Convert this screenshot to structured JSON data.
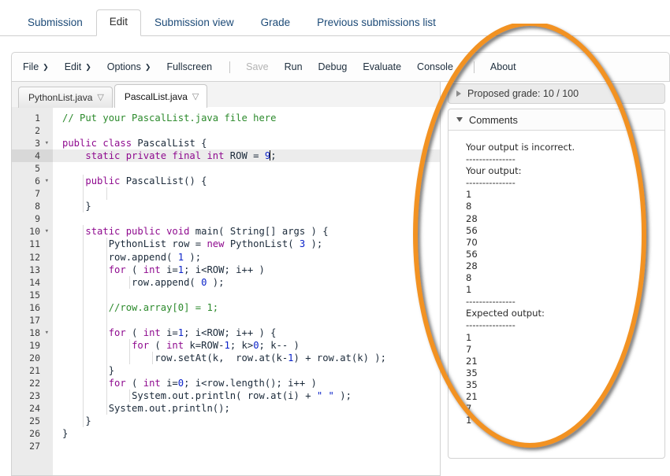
{
  "nav": {
    "tabs": [
      {
        "label": "Submission",
        "active": false
      },
      {
        "label": "Edit",
        "active": true
      },
      {
        "label": "Submission view",
        "active": false
      },
      {
        "label": "Grade",
        "active": false
      },
      {
        "label": "Previous submissions list",
        "active": false
      }
    ]
  },
  "toolbar": {
    "file": "File",
    "edit": "Edit",
    "options": "Options",
    "fullscreen": "Fullscreen",
    "save": "Save",
    "run": "Run",
    "debug": "Debug",
    "evaluate": "Evaluate",
    "console": "Console",
    "about": "About",
    "caret": "❯"
  },
  "filetabs": [
    {
      "label": "PythonList.java",
      "active": false,
      "menu_icon": "▽"
    },
    {
      "label": "PascalList.java",
      "active": true,
      "menu_icon": "▽"
    }
  ],
  "editor": {
    "active_line": 4,
    "lines": [
      {
        "n": "1",
        "fold": "",
        "indent": 0,
        "html": "<span class=\"cm\">// Put your PascalList.java file here</span>"
      },
      {
        "n": "2",
        "fold": "",
        "indent": 0,
        "html": ""
      },
      {
        "n": "3",
        "fold": "▾",
        "indent": 0,
        "html": "<span class=\"k\">public class</span> <span class=\"id\">PascalList</span> {"
      },
      {
        "n": "4",
        "fold": "",
        "indent": 0,
        "html": "    <span class=\"k\">static private final int</span> ROW = <span class=\"n\">9</span><span class=\"caret\"></span>;"
      },
      {
        "n": "5",
        "fold": "",
        "indent": 0,
        "html": ""
      },
      {
        "n": "6",
        "fold": "▾",
        "indent": 1,
        "html": "    <span class=\"k\">public</span> <span class=\"id\">PascalList</span>() {"
      },
      {
        "n": "7",
        "fold": "",
        "indent": 2,
        "html": ""
      },
      {
        "n": "8",
        "fold": "",
        "indent": 1,
        "html": "    }"
      },
      {
        "n": "9",
        "fold": "",
        "indent": 0,
        "html": ""
      },
      {
        "n": "10",
        "fold": "▾",
        "indent": 1,
        "html": "    <span class=\"k\">static public void</span> main( <span class=\"id\">String</span>[] args ) {"
      },
      {
        "n": "11",
        "fold": "",
        "indent": 2,
        "html": "        <span class=\"id\">PythonList</span> row = <span class=\"k\">new</span> <span class=\"id\">PythonList</span>( <span class=\"n\">3</span> );"
      },
      {
        "n": "12",
        "fold": "",
        "indent": 2,
        "html": "        row.append( <span class=\"n\">1</span> );"
      },
      {
        "n": "13",
        "fold": "",
        "indent": 2,
        "html": "        <span class=\"k\">for</span> ( <span class=\"k\">int</span> i=<span class=\"n\">1</span>; i&lt;ROW; i++ )"
      },
      {
        "n": "14",
        "fold": "",
        "indent": 3,
        "html": "            row.append( <span class=\"n\">0</span> );"
      },
      {
        "n": "15",
        "fold": "",
        "indent": 2,
        "html": ""
      },
      {
        "n": "16",
        "fold": "",
        "indent": 2,
        "html": "        <span class=\"cm\">//row.array[0] = 1;</span>"
      },
      {
        "n": "17",
        "fold": "",
        "indent": 2,
        "html": ""
      },
      {
        "n": "18",
        "fold": "▾",
        "indent": 2,
        "html": "        <span class=\"k\">for</span> ( <span class=\"k\">int</span> i=<span class=\"n\">1</span>; i&lt;ROW; i++ ) {"
      },
      {
        "n": "19",
        "fold": "",
        "indent": 3,
        "html": "            <span class=\"k\">for</span> ( <span class=\"k\">int</span> k=ROW-<span class=\"n\">1</span>; k&gt;<span class=\"n\">0</span>; k-- )"
      },
      {
        "n": "20",
        "fold": "",
        "indent": 4,
        "html": "                row.setAt(k,  row.at(k-<span class=\"n\">1</span>) + row.at(k) );"
      },
      {
        "n": "21",
        "fold": "",
        "indent": 2,
        "html": "        }"
      },
      {
        "n": "22",
        "fold": "",
        "indent": 2,
        "html": "        <span class=\"k\">for</span> ( <span class=\"k\">int</span> i=<span class=\"n\">0</span>; i&lt;row.length(); i++ )"
      },
      {
        "n": "23",
        "fold": "",
        "indent": 3,
        "html": "            <span class=\"id\">System</span>.out.println( row.at(i) + <span class=\"st\">\" \"</span> );"
      },
      {
        "n": "24",
        "fold": "",
        "indent": 2,
        "html": "        <span class=\"id\">System</span>.out.println();"
      },
      {
        "n": "25",
        "fold": "",
        "indent": 1,
        "html": "    }"
      },
      {
        "n": "26",
        "fold": "",
        "indent": 0,
        "html": "}"
      },
      {
        "n": "27",
        "fold": "",
        "indent": 0,
        "html": ""
      }
    ]
  },
  "grade_panel": {
    "label": "Proposed grade: 10 / 100",
    "score": "10",
    "max": "100",
    "expanded": false
  },
  "comments_panel": {
    "title": "Comments",
    "expanded": true,
    "lines": [
      "Your output is incorrect.",
      "---------------",
      "Your output:",
      "---------------",
      "1",
      "8",
      "28",
      "56",
      "70",
      "56",
      "28",
      "8",
      "1",
      "---------------",
      "Expected output:",
      "---------------",
      "1",
      "7",
      "21",
      "35",
      "35",
      "21",
      "7",
      "1"
    ],
    "your_output": [
      "1",
      "8",
      "28",
      "56",
      "70",
      "56",
      "28",
      "8",
      "1"
    ],
    "expected_output": [
      "1",
      "7",
      "21",
      "35",
      "35",
      "21",
      "7",
      "1"
    ]
  },
  "annotation": {
    "shape": "ellipse",
    "color": "#F29220",
    "stroke_width": "6"
  }
}
